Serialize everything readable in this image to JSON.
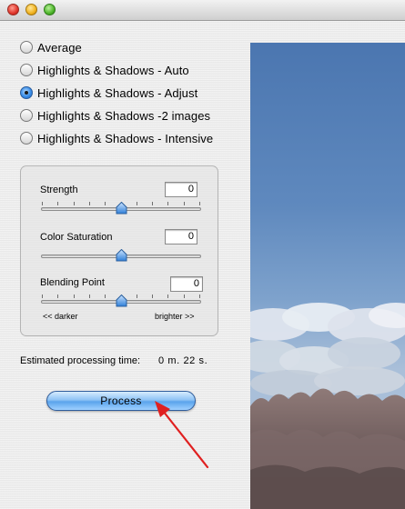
{
  "window": {
    "traffic_lights": [
      {
        "name": "close",
        "color": "#e0352b"
      },
      {
        "name": "minimize",
        "color": "#f0b21f"
      },
      {
        "name": "zoom",
        "color": "#4eb52a"
      }
    ]
  },
  "modes": {
    "selected_index": 2,
    "options": [
      {
        "label": "Average",
        "checked": false
      },
      {
        "label": "Highlights & Shadows - Auto",
        "checked": false
      },
      {
        "label": "Highlights & Shadows - Adjust",
        "checked": true
      },
      {
        "label": "Highlights & Shadows -2 images",
        "checked": false
      },
      {
        "label": "Highlights & Shadows - Intensive",
        "checked": false
      }
    ]
  },
  "adjustments": {
    "strength": {
      "label": "Strength",
      "value": "0",
      "position": 0.5
    },
    "color_saturation": {
      "label": "Color Saturation",
      "value": "0",
      "position": 0.5
    },
    "blending_point": {
      "label": "Blending Point",
      "value": "0",
      "position": 0.5
    },
    "scale_left": "<< darker",
    "scale_right": "brighter >>"
  },
  "estimate": {
    "label": "Estimated processing time:",
    "value": "0 m. 22 s."
  },
  "process_button": {
    "label": "Process"
  },
  "colors": {
    "accent": "#5aa3ec",
    "annotation_arrow": "#e02020",
    "sky": "#5a83b8"
  }
}
